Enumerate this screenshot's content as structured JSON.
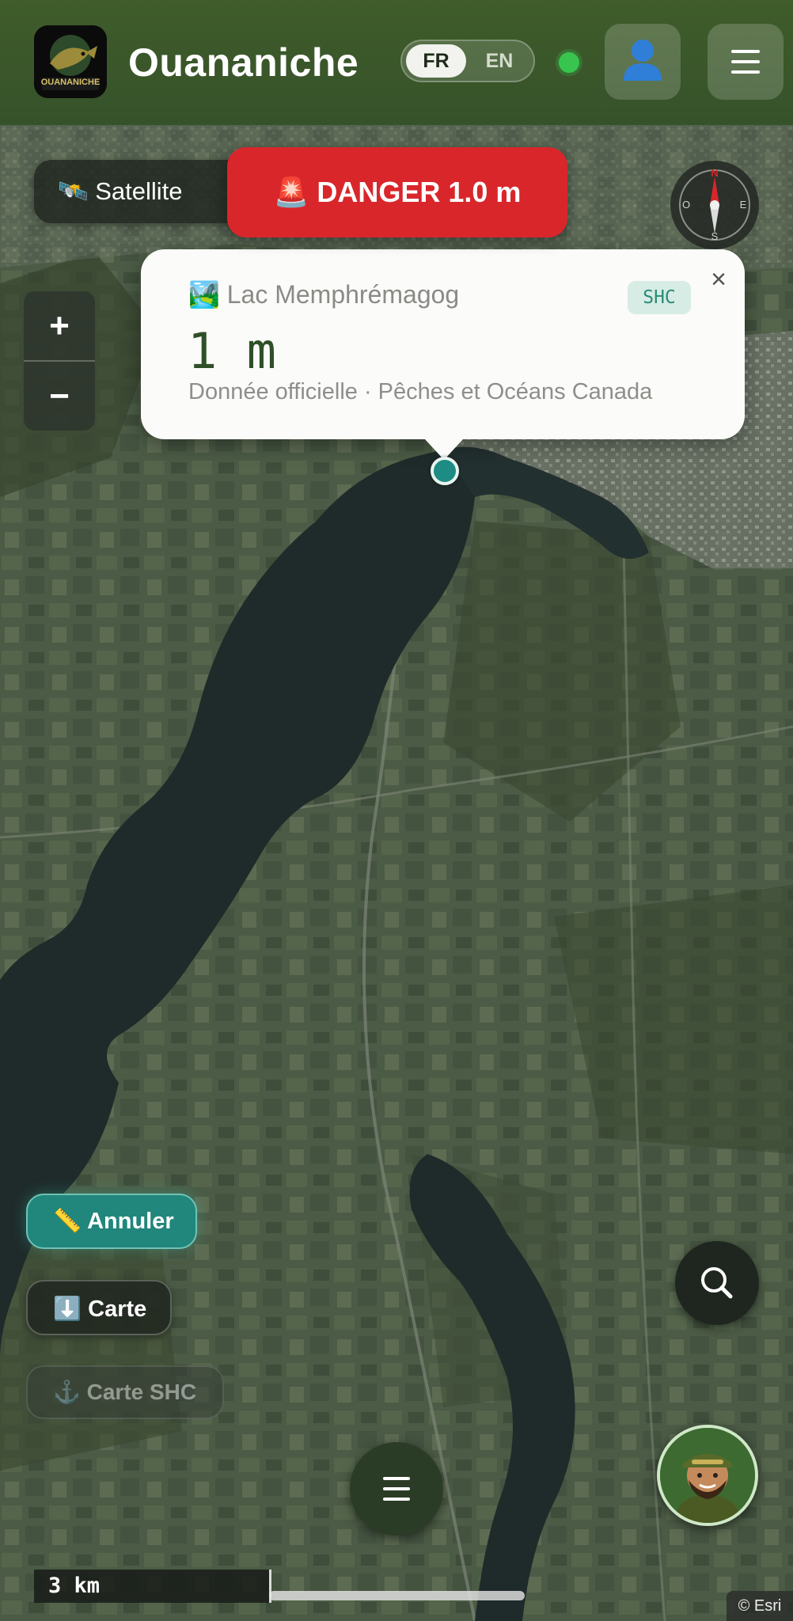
{
  "header": {
    "title": "Ouananiche",
    "logo_text": "OUANANICHE",
    "lang_options": [
      "FR",
      "EN"
    ],
    "lang_selected": "FR",
    "status": "online",
    "user_icon": "user-icon",
    "menu_icon": "hamburger-icon"
  },
  "map": {
    "layer_button_label": "🛰️ Satellite",
    "danger_label": "🚨 DANGER 1.0 m",
    "compass": {
      "n": "N",
      "s": "S",
      "e": "E",
      "o": "O"
    },
    "zoom_in": "+",
    "zoom_out": "−",
    "scale_label": "3 km",
    "attribution": "© Esri"
  },
  "popup": {
    "name": "🏞️ Lac Memphrémagog",
    "depth": "1 m",
    "source": "Donnée officielle · Pêches et Océans Canada",
    "badge": "SHC",
    "close": "×"
  },
  "tools": {
    "cancel_label": "📏 Annuler",
    "download_label": "⬇️ Carte",
    "shc_label": "⚓ Carte SHC"
  },
  "colors": {
    "header": "#3f5c2a",
    "danger": "#d9262b",
    "accent_teal": "#21867b",
    "status_green": "#38c44f"
  }
}
